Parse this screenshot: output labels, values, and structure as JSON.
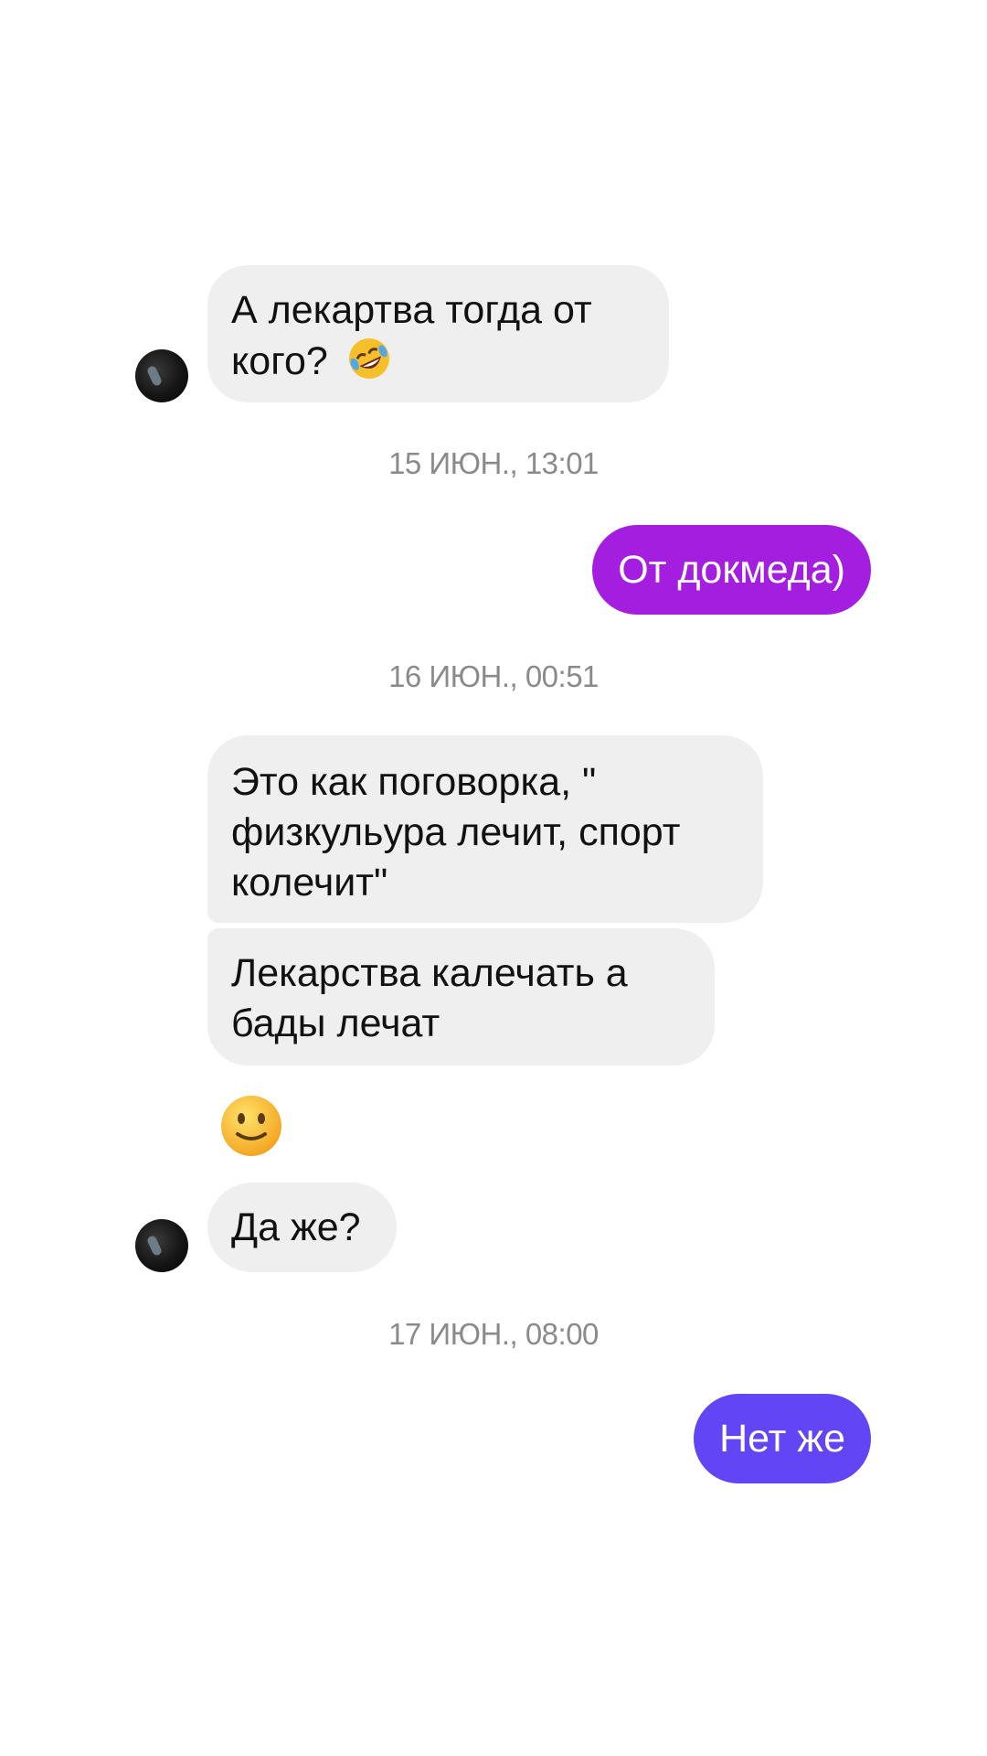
{
  "messages": [
    {
      "id": "m1",
      "text": "А лекартва тогда от кого?",
      "emoji": "rolling-on-floor-laughing-icon"
    },
    {
      "id": "t1",
      "timestamp": "15 ИЮН., 13:01"
    },
    {
      "id": "m2",
      "text": "От докмеда)"
    },
    {
      "id": "t2",
      "timestamp": "16 ИЮН., 00:51"
    },
    {
      "id": "m3",
      "text": "Это как поговорка, \" физкульура лечит, спорт колечит\""
    },
    {
      "id": "m4",
      "text": "Лекарства калечать а бады лечат"
    },
    {
      "id": "m5",
      "emoji": "slightly-smiling-face-icon"
    },
    {
      "id": "m6",
      "text": "Да же?"
    },
    {
      "id": "t3",
      "timestamp": "17 ИЮН., 08:00"
    },
    {
      "id": "m7",
      "text": "Нет же"
    }
  ],
  "colors": {
    "incoming_bubble": "#efefef",
    "outgoing_purple": "#a41ee0",
    "outgoing_indigo": "#6246f5",
    "timestamp": "#8a8a8a"
  }
}
